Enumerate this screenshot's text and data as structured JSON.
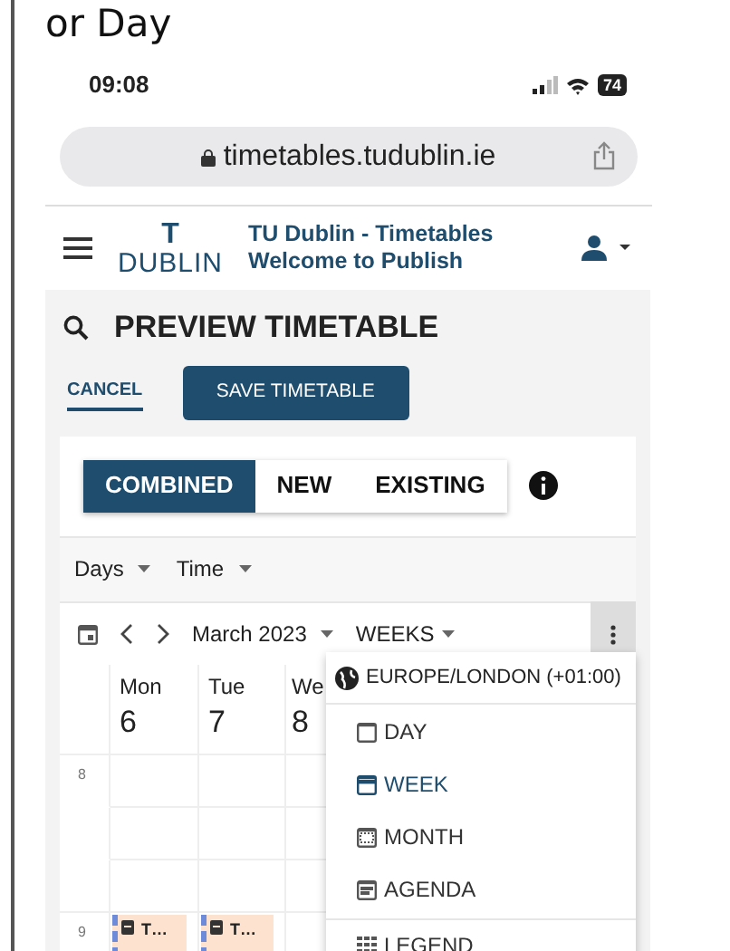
{
  "caption": "or Day",
  "status_bar": {
    "time": "09:08",
    "battery": "74"
  },
  "url_bar": {
    "url": "timetables.tudublin.ie"
  },
  "header": {
    "logo_top": "T",
    "logo_bottom": "DUBLIN",
    "title": "TU Dublin - Timetables",
    "subtitle": "Welcome to Publish"
  },
  "page": {
    "title": "PREVIEW TIMETABLE",
    "cancel": "CANCEL",
    "save": "SAVE TIMETABLE"
  },
  "modes": [
    {
      "label": "COMBINED",
      "selected": true
    },
    {
      "label": "NEW",
      "selected": false
    },
    {
      "label": "EXISTING",
      "selected": false
    }
  ],
  "filters": [
    {
      "label": "Days"
    },
    {
      "label": "Time"
    }
  ],
  "toolbar": {
    "month": "March 2023",
    "view": "WEEKS"
  },
  "days": [
    {
      "name": "Mon",
      "date": "6",
      "events": [
        {
          "title": "T…"
        }
      ]
    },
    {
      "name": "Tue",
      "date": "7",
      "events": [
        {
          "title": "T…"
        }
      ]
    },
    {
      "name": "We",
      "date": "8"
    }
  ],
  "hours": [
    "8",
    "9"
  ],
  "menu": {
    "timezone": "EUROPE/LONDON (+01:00)",
    "items": [
      {
        "label": "DAY",
        "kind": "day",
        "selected": false
      },
      {
        "label": "WEEK",
        "kind": "week",
        "selected": true
      },
      {
        "label": "MONTH",
        "kind": "month",
        "selected": false
      },
      {
        "label": "AGENDA",
        "kind": "agenda",
        "selected": false
      }
    ],
    "legend": "LEGEND"
  }
}
